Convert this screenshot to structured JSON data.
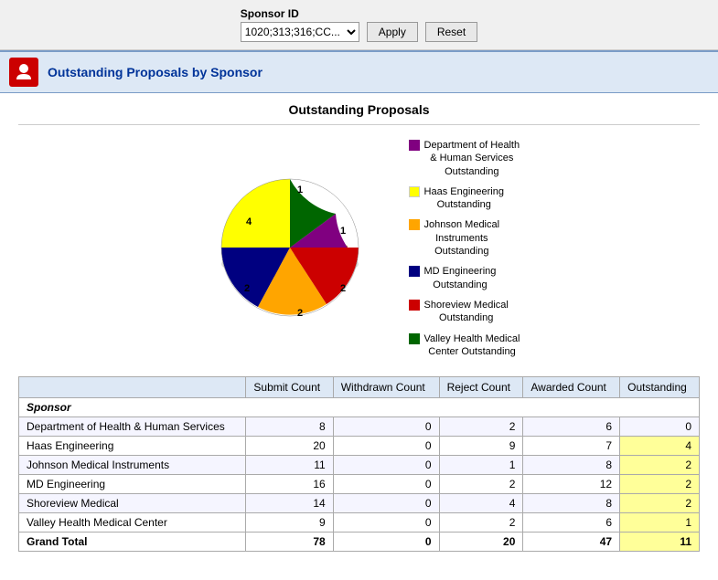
{
  "topbar": {
    "sponsor_id_label": "Sponsor ID",
    "sponsor_id_value": "1020;313;316;CC...",
    "apply_label": "Apply",
    "reset_label": "Reset"
  },
  "header": {
    "title": "Outstanding Proposals by Sponsor"
  },
  "chart": {
    "title": "Outstanding Proposals",
    "slices": [
      {
        "id": "dept-health",
        "color": "#800080",
        "label": "Department of Health & Human Services Outstanding",
        "value": 0,
        "pieLabel": "1",
        "percent": 9
      },
      {
        "id": "haas-eng",
        "color": "#ffff00",
        "label": "Haas Engineering Outstanding",
        "value": 4,
        "pieLabel": "4",
        "percent": 36
      },
      {
        "id": "johnson-med",
        "color": "#ffa500",
        "label": "Johnson Medical Instruments Outstanding",
        "value": 2,
        "pieLabel": "2",
        "percent": 18
      },
      {
        "id": "md-eng",
        "color": "#000080",
        "label": "MD Engineering Outstanding",
        "value": 2,
        "pieLabel": "2",
        "percent": 18
      },
      {
        "id": "shoreview",
        "color": "#cc0000",
        "label": "Shoreview Medical Outstanding",
        "value": 2,
        "pieLabel": "2",
        "percent": 9
      },
      {
        "id": "valley",
        "color": "#006600",
        "label": "Valley Health Medical Center Outstanding",
        "value": 1,
        "pieLabel": "1",
        "percent": 9
      }
    ]
  },
  "table": {
    "headers": [
      "",
      "Submit Count",
      "Withdrawn Count",
      "Reject Count",
      "Awarded Count",
      "Outstanding"
    ],
    "sponsor_row": "Sponsor",
    "rows": [
      {
        "name": "Department of Health & Human Services",
        "submit": 8,
        "withdrawn": 0,
        "reject": 2,
        "awarded": 6,
        "outstanding": 0,
        "highlight": true
      },
      {
        "name": "Haas Engineering",
        "submit": 20,
        "withdrawn": 0,
        "reject": 9,
        "awarded": 7,
        "outstanding": 4,
        "highlight": true
      },
      {
        "name": "Johnson Medical Instruments",
        "submit": 11,
        "withdrawn": 0,
        "reject": 1,
        "awarded": 8,
        "outstanding": 2,
        "highlight": true
      },
      {
        "name": "MD Engineering",
        "submit": 16,
        "withdrawn": 0,
        "reject": 2,
        "awarded": 12,
        "outstanding": 2,
        "highlight": true
      },
      {
        "name": "Shoreview Medical",
        "submit": 14,
        "withdrawn": 0,
        "reject": 4,
        "awarded": 8,
        "outstanding": 2,
        "highlight": true
      },
      {
        "name": "Valley Health Medical Center",
        "submit": 9,
        "withdrawn": 0,
        "reject": 2,
        "awarded": 6,
        "outstanding": 1,
        "highlight": true
      }
    ],
    "grand_total": {
      "label": "Grand Total",
      "submit": 78,
      "withdrawn": 0,
      "reject": 20,
      "awarded": 47,
      "outstanding": 11
    }
  }
}
